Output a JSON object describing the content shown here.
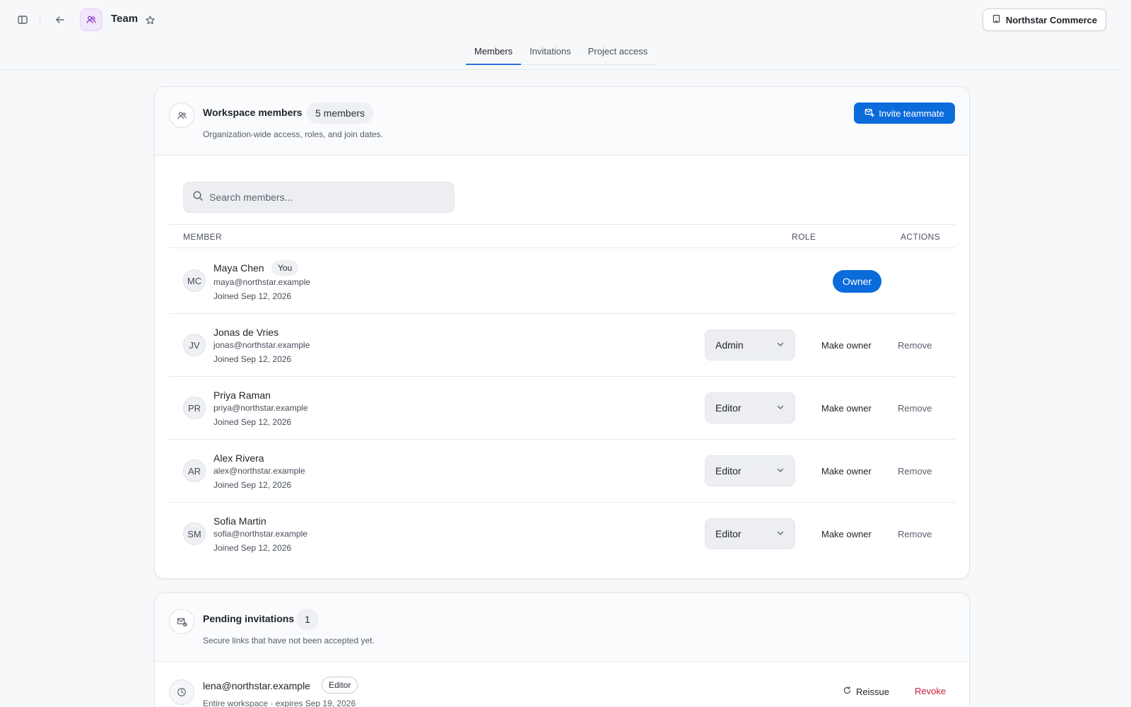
{
  "header": {
    "title": "Team",
    "org_name": "Northstar Commerce"
  },
  "tabs": [
    {
      "label": "Members",
      "active": true
    },
    {
      "label": "Invitations",
      "active": false
    },
    {
      "label": "Project access",
      "active": false
    }
  ],
  "members_card": {
    "title": "Workspace members",
    "count_badge": "5 members",
    "subtitle": "Organization-wide access, roles, and join dates.",
    "invite_label": "Invite teammate",
    "search_placeholder": "Search members...",
    "columns": {
      "member": "MEMBER",
      "role": "ROLE",
      "actions": "ACTIONS"
    },
    "make_owner_label": "Make owner",
    "remove_label": "Remove",
    "members": [
      {
        "initials": "MC",
        "name": "Maya Chen",
        "badge": "You",
        "email": "maya@northstar.example",
        "joined": "Joined Sep 12, 2026",
        "role": "Owner"
      },
      {
        "initials": "JV",
        "name": "Jonas de Vries",
        "email": "jonas@northstar.example",
        "joined": "Joined Sep 12, 2026",
        "role": "Admin"
      },
      {
        "initials": "PR",
        "name": "Priya Raman",
        "email": "priya@northstar.example",
        "joined": "Joined Sep 12, 2026",
        "role": "Editor"
      },
      {
        "initials": "AR",
        "name": "Alex Rivera",
        "email": "alex@northstar.example",
        "joined": "Joined Sep 12, 2026",
        "role": "Editor"
      },
      {
        "initials": "SM",
        "name": "Sofia Martin",
        "email": "sofia@northstar.example",
        "joined": "Joined Sep 12, 2026",
        "role": "Editor"
      }
    ]
  },
  "pending_card": {
    "title": "Pending invitations",
    "count_badge": "1",
    "subtitle": "Secure links that have not been accepted yet.",
    "invitations": [
      {
        "email": "lena@northstar.example",
        "role": "Editor",
        "detail": "Entire workspace · expires Sep 19, 2026",
        "reissue_label": "Reissue",
        "revoke_label": "Revoke"
      }
    ]
  },
  "colors": {
    "accent": "#0b6bdb",
    "danger": "#c4213a",
    "app_icon_bg": "#f1e6fb"
  },
  "icons": [
    "sidebar-toggle-icon",
    "back-arrow-icon",
    "team-icon",
    "star-icon",
    "building-icon",
    "users-icon",
    "user-plus-icon",
    "search-icon",
    "chevron-down-icon",
    "mail-icon",
    "clock-icon",
    "refresh-icon"
  ]
}
